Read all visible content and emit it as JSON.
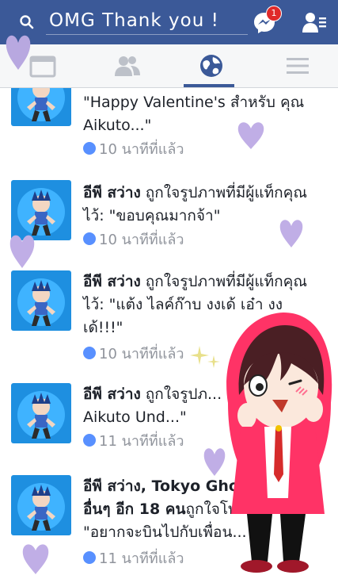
{
  "header": {
    "search_value": "OMG Thank you !",
    "messenger_badge": "1",
    "brand_color": "#3b5998"
  },
  "tabs": [
    {
      "name": "news-feed",
      "icon": "news-feed-icon"
    },
    {
      "name": "friends",
      "icon": "friends-icon"
    },
    {
      "name": "notifications",
      "icon": "globe-icon",
      "active": true
    },
    {
      "name": "more",
      "icon": "menu-icon"
    }
  ],
  "notifications": [
    {
      "actor": "",
      "text": "\"Happy Valentine's สำหรับ คุณ Aikuto...\"",
      "time": "10 นาทีที่แล้ว"
    },
    {
      "actor": "อีพี สว่าง",
      "text": " ถูกใจรูปภาพที่มีผู้แท็กคุณไว้: \"ขอบคุณมากจ้า\"",
      "time": "10 นาทีที่แล้ว"
    },
    {
      "actor": "อีพี สว่าง",
      "text": " ถูกใจรูปภาพที่มีผู้แท็กคุณไว้: \"แต้ง ไลค์ก๊าบ งงเด้ เอ๋า งงเด้!!!\"",
      "time": "10 นาทีที่แล้ว"
    },
    {
      "actor": "อีพี สว่าง",
      "text": " ถูกใจรูปภ... \"เอารูปนี้ให้ Aikuto Und...\"",
      "time": "11 นาทีที่แล้ว"
    },
    {
      "actor": "อีพี สว่าง, Tokyo Ghoul... และอื่นๆ อีก 18 คน",
      "text": "ถูกใจโพสต์ของคุณ : \"อยากจะบินไปกับเพื่อน... ^\"",
      "time": "11 นาทีที่แล้ว"
    }
  ]
}
